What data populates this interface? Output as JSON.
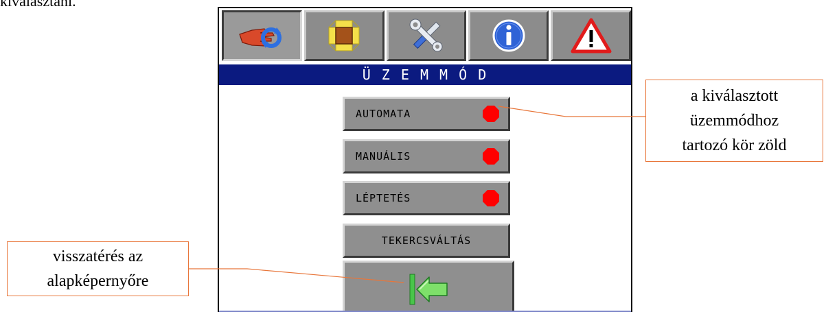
{
  "top_text": "kiválasztani.",
  "tabs": [
    {
      "icon": "hand-cycle-icon",
      "active": true
    },
    {
      "icon": "coil-icon",
      "active": false
    },
    {
      "icon": "tools-icon",
      "active": false
    },
    {
      "icon": "info-icon",
      "active": false
    },
    {
      "icon": "warning-icon",
      "active": false
    }
  ],
  "title": "ÜZEMMÓD",
  "modes": [
    {
      "label": "AUTOMATA",
      "indicator": "red"
    },
    {
      "label": "MANUÁLIS",
      "indicator": "red"
    },
    {
      "label": "LÉPTETÉS",
      "indicator": "red"
    },
    {
      "label": "TEKERCSVÁLTÁS",
      "indicator": null
    }
  ],
  "back_button": {
    "icon": "green-back-arrow-icon"
  },
  "callouts": {
    "right": {
      "line1": "a kiválasztott",
      "line2": "üzemmódhoz",
      "line3": "tartozó kör zöld"
    },
    "left": {
      "line1": "visszatérés az",
      "line2": "alapképernyőre"
    }
  },
  "colors": {
    "title_bg": "#0b1a80",
    "indicator_red": "#ff0000",
    "callout_border": "#e8763a",
    "button_gray": "#8f8f8f"
  }
}
